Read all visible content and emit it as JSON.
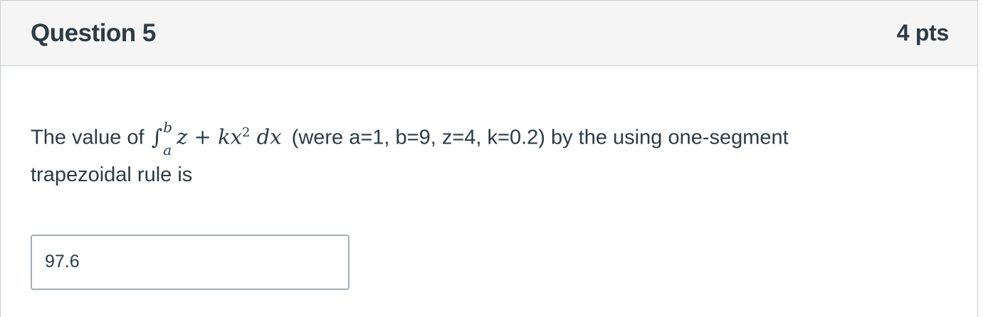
{
  "question": {
    "title": "Question 5",
    "points": "4 pts",
    "text_before": "The value of",
    "math": {
      "integral_symbol": "∫",
      "upper_limit": "b",
      "lower_limit": "a",
      "integrand": "z + kx",
      "exponent": "2",
      "differential": " dx"
    },
    "text_after": "(were a=1, b=9, z=4, k=0.2) by the using one-segment trapezoidal rule is",
    "answer_value": "97.6"
  }
}
